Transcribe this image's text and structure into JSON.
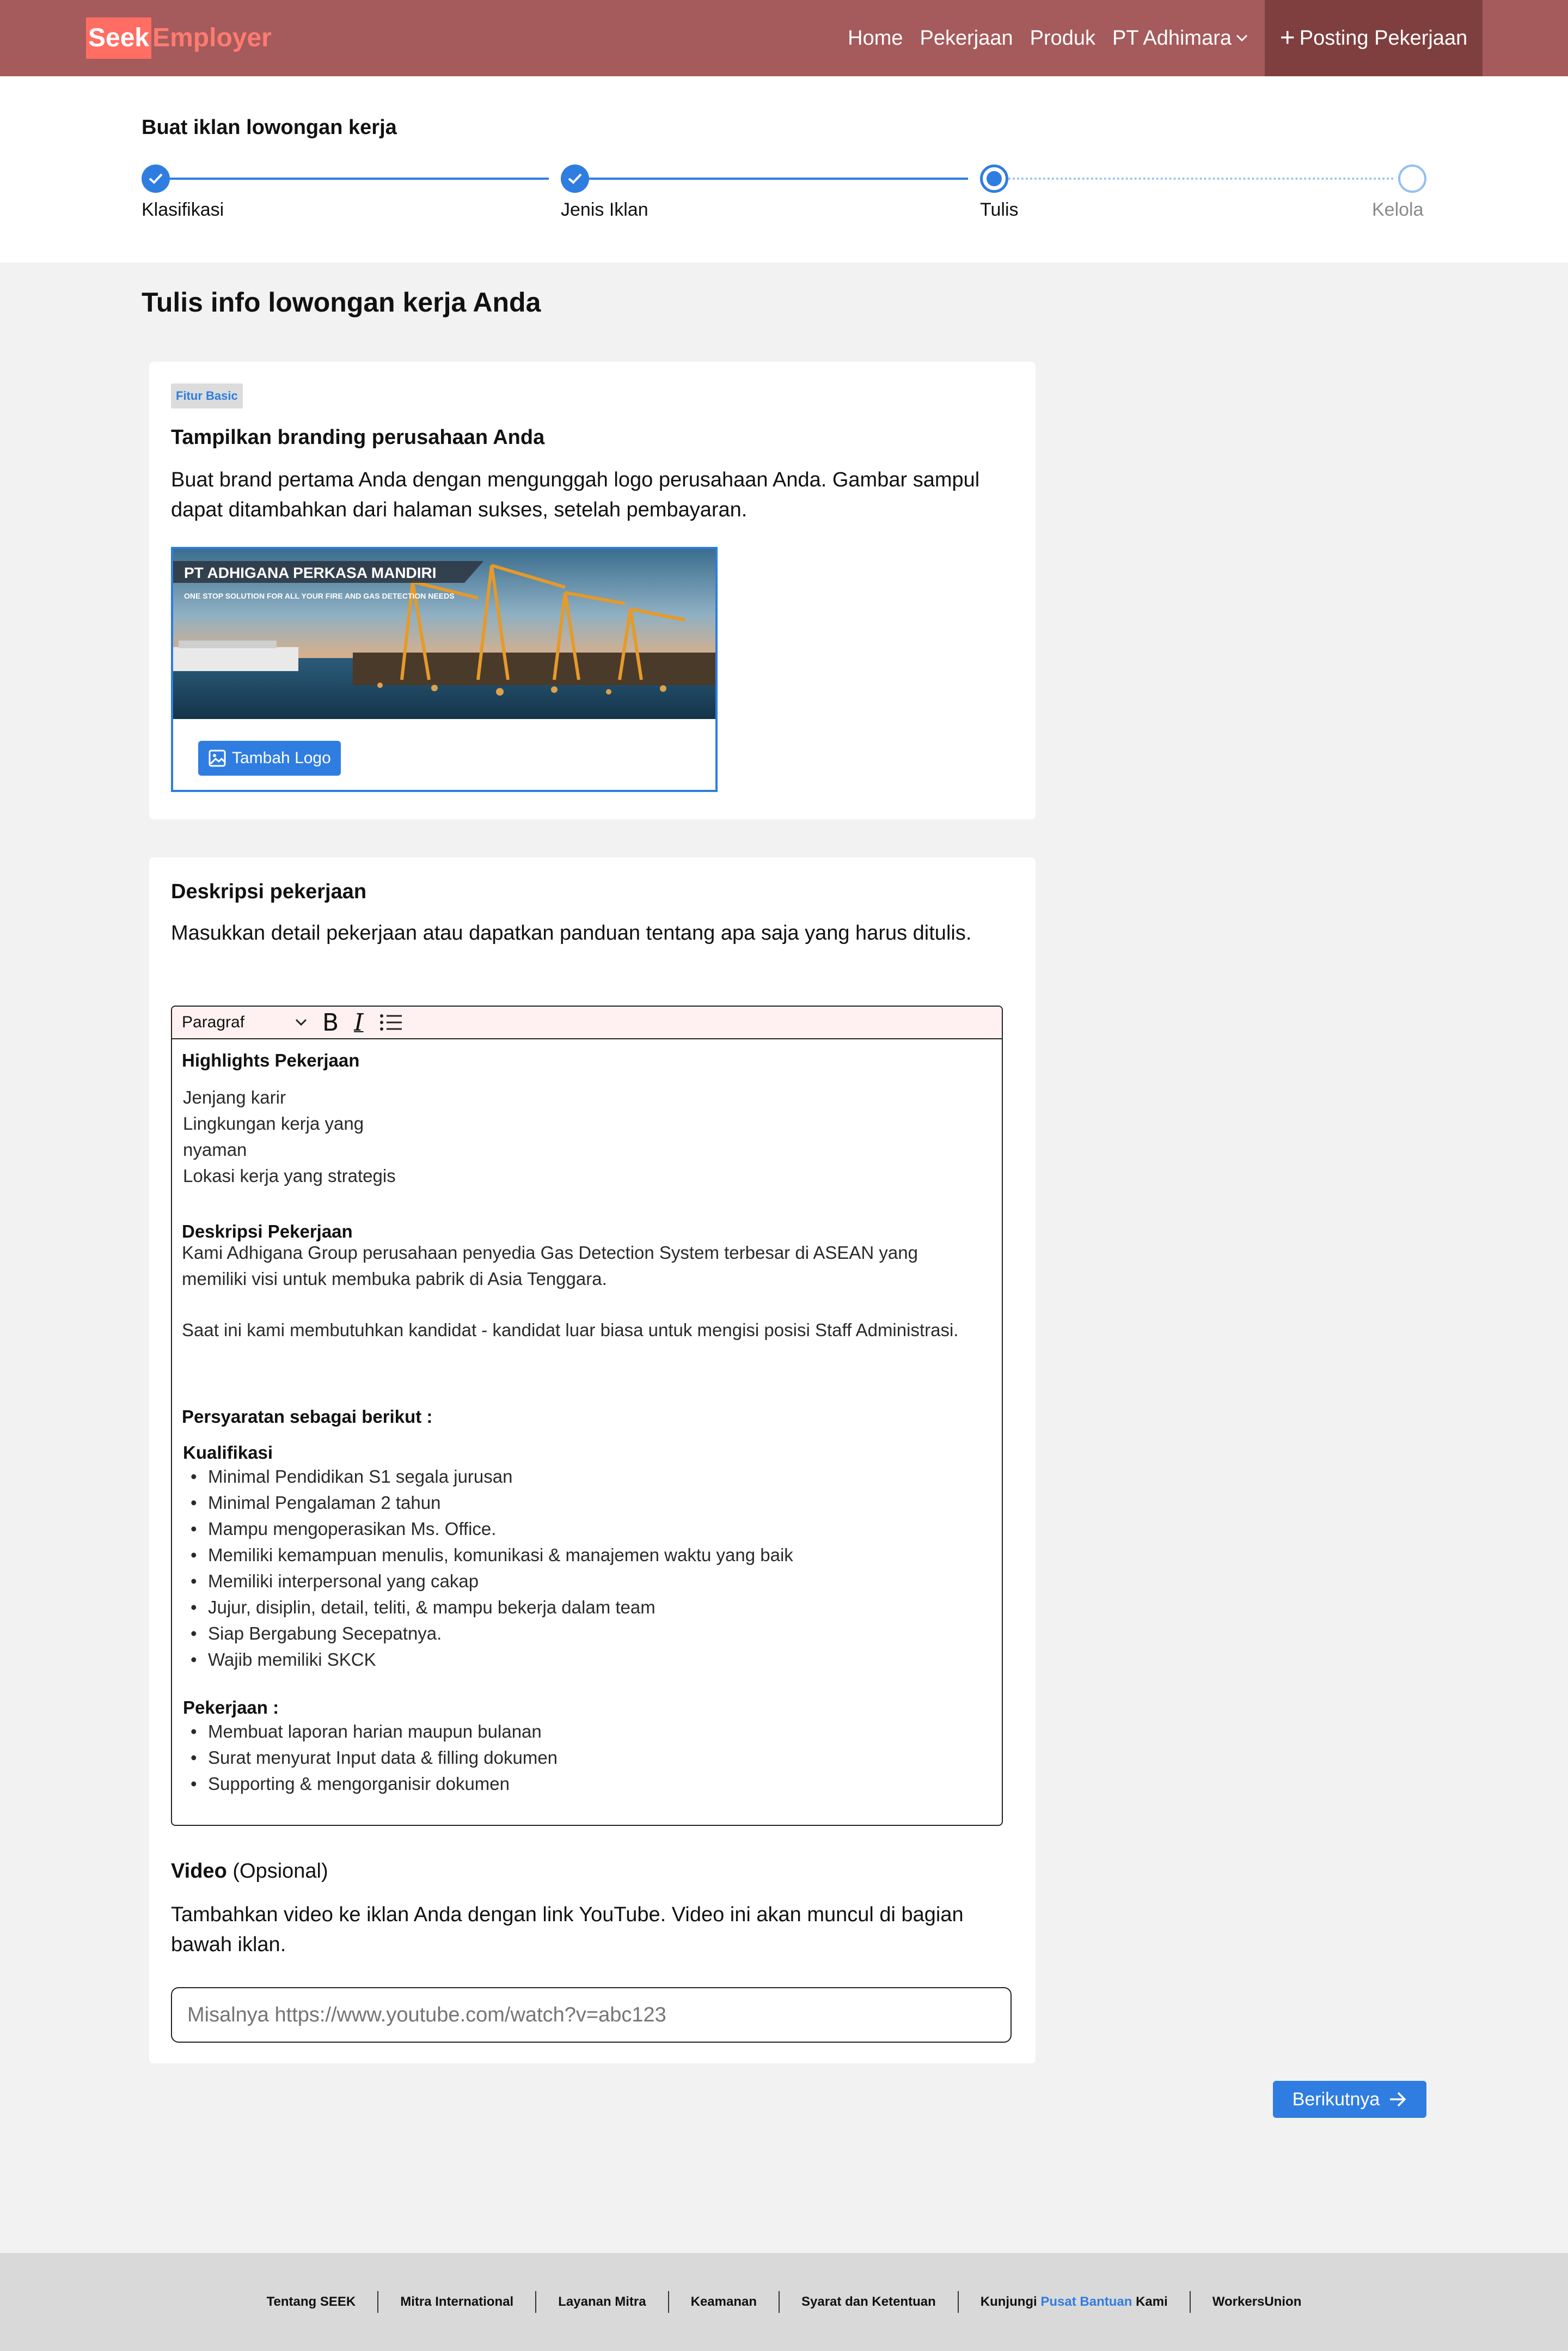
{
  "header": {
    "brand_part1": "Seek",
    "brand_part2": "Employer",
    "nav": [
      "Home",
      "Pekerjaan",
      "Produk"
    ],
    "company": "PT Adhimara",
    "post_job": "Posting Pekerjaan"
  },
  "stepper": {
    "title": "Buat iklan lowongan kerja",
    "steps": [
      {
        "label": "Klasifikasi",
        "state": "done"
      },
      {
        "label": "Jenis Iklan",
        "state": "done"
      },
      {
        "label": "Tulis",
        "state": "active"
      },
      {
        "label": "Kelola",
        "state": "todo"
      }
    ]
  },
  "page_title": "Tulis info lowongan kerja Anda",
  "branding": {
    "badge": "Fitur Basic",
    "heading": "Tampilkan branding perusahaan Anda",
    "text": "Buat brand pertama Anda dengan mengunggah logo perusahaan Anda. Gambar sampul dapat ditambahkan dari halaman sukses, setelah pembayaran.",
    "banner_title": "PT ADHIGANA PERKASA MANDIRI",
    "banner_subtitle": "ONE STOP SOLUTION FOR ALL YOUR FIRE AND GAS DETECTION NEEDS",
    "add_logo": "Tambah Logo"
  },
  "description": {
    "heading": "Deskripsi pekerjaan",
    "text": "Masukkan detail pekerjaan atau dapatkan panduan tentang apa saja yang harus ditulis.",
    "toolbar": {
      "format": "Paragraf",
      "bold": "B",
      "italic": "I"
    },
    "content": {
      "highlights_title": "Highlights Pekerjaan",
      "highlights": [
        "Jenjang karir",
        "Lingkungan kerja yang",
        "nyaman",
        "Lokasi kerja yang strategis"
      ],
      "desc_title": "Deskripsi Pekerjaan",
      "desc_p1": "Kami Adhigana Group perusahaan penyedia Gas Detection System terbesar di ASEAN yang memiliki visi untuk membuka pabrik di Asia Tenggara.",
      "desc_p2": "Saat ini kami membutuhkan kandidat - kandidat luar biasa untuk mengisi posisi Staff Administrasi.",
      "requirements_title": "Persyaratan sebagai berikut :",
      "qualifications_title": "Kualifikasi",
      "qualifications": [
        "Minimal Pendidikan S1 segala jurusan",
        "Minimal Pengalaman 2 tahun",
        "Mampu mengoperasikan Ms. Office.",
        "Memiliki kemampuan menulis, komunikasi & manajemen waktu yang baik",
        "Memiliki interpersonal yang cakap",
        "Jujur, disiplin, detail, teliti, & mampu bekerja dalam team",
        "Siap Bergabung Secepatnya.",
        "Wajib memiliki SKCK"
      ],
      "jobs_title": "Pekerjaan :",
      "jobs": [
        "Membuat laporan harian maupun bulanan",
        "Surat menyurat Input data & filling dokumen",
        "Supporting & mengorganisir dokumen"
      ]
    },
    "video_title": "Video",
    "video_optional": "(Opsional)",
    "video_text": "Tambahkan video ke iklan Anda dengan link YouTube. Video ini akan muncul di bagian bawah iklan.",
    "video_placeholder": "Misalnya https://www.youtube.com/watch?v=abc123"
  },
  "next_button": "Berikutnya",
  "footer": {
    "links": [
      "Tentang SEEK",
      "Mitra International",
      "Layanan Mitra",
      "Keamanan",
      "Syarat dan Ketentuan"
    ],
    "help_prefix": "Kunjungi",
    "help_link": "Pusat Bantuan",
    "help_suffix": "Kami",
    "last": "WorkersUnion"
  },
  "colors": {
    "header": "#a55a5c",
    "accent": "#2f7de1",
    "brand": "#ff6d63"
  }
}
